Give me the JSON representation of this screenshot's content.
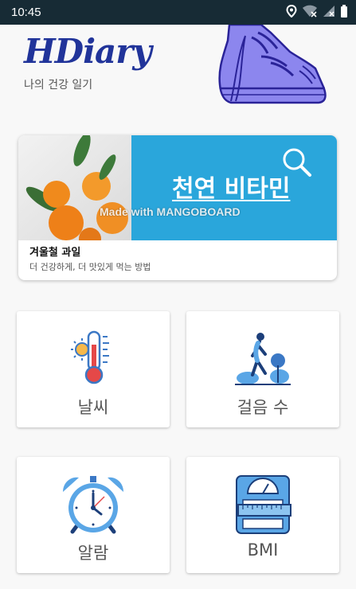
{
  "status_bar": {
    "time": "10:45"
  },
  "header": {
    "title": "HDiary",
    "subtitle": "나의 건강 일기"
  },
  "banner": {
    "headline": "천연 비타민",
    "watermark": "Made with MANGOBOARD",
    "title": "겨울철 과일",
    "description": "더 건강하게, 더 맛있게 먹는 방법"
  },
  "tiles": [
    {
      "label": "날씨",
      "icon": "thermometer-icon"
    },
    {
      "label": "걸음 수",
      "icon": "walking-person-icon"
    },
    {
      "label": "알람",
      "icon": "alarm-clock-icon"
    },
    {
      "label": "BMI",
      "icon": "scale-icon"
    }
  ],
  "colors": {
    "status_bar": "#172b35",
    "title": "#21349a",
    "banner_blue": "#2aa6db",
    "icon_blue": "#4a90d9"
  }
}
